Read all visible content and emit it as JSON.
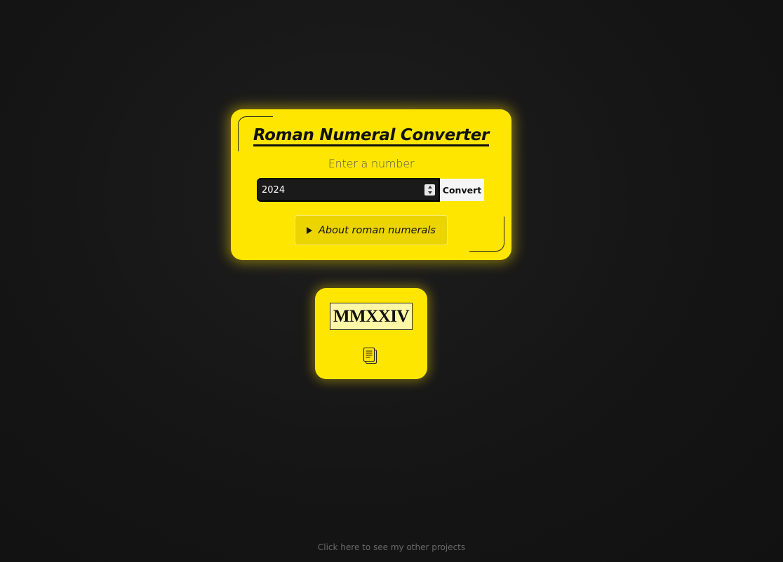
{
  "converter": {
    "title": "Roman Numeral Converter",
    "prompt": "Enter a number",
    "input_value": "2024",
    "convert_label": "Convert",
    "about_label": "About roman numerals"
  },
  "result": {
    "roman": "MMXXIV",
    "copy_icon": "copy-icon"
  },
  "footer": {
    "link_text": "Click here to see my other projects"
  },
  "colors": {
    "accent": "#ffe600",
    "background": "#151515",
    "input_bg": "#1a1a1a",
    "result_bg": "#fff7a8"
  }
}
